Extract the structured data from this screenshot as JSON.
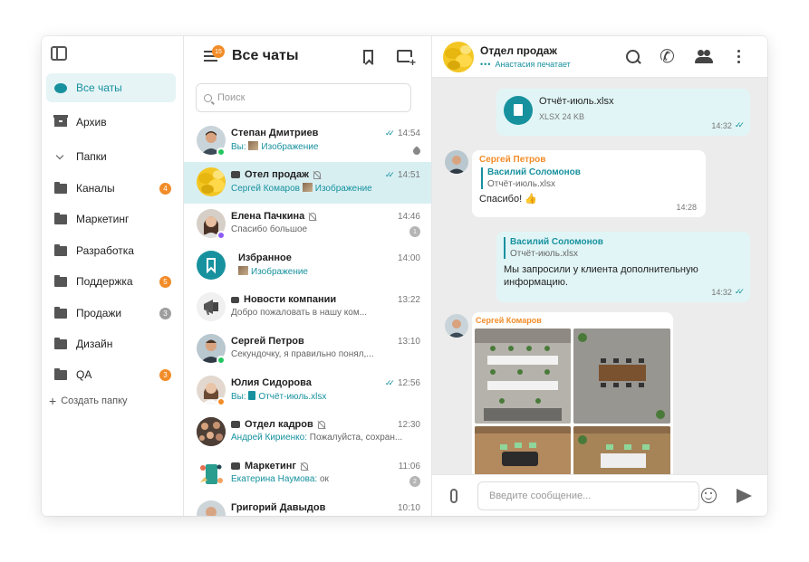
{
  "nav": {
    "items": [
      {
        "label": "Все чаты",
        "icon": "chat-icon",
        "active": true
      },
      {
        "label": "Архив",
        "icon": "archive-icon"
      },
      {
        "label": "Папки",
        "icon": "chevron-down-icon"
      },
      {
        "label": "Каналы",
        "icon": "folder-icon",
        "badge": "4",
        "badge_color": "orange"
      },
      {
        "label": "Маркетинг",
        "icon": "folder-icon"
      },
      {
        "label": "Разработка",
        "icon": "folder-icon"
      },
      {
        "label": "Поддержка",
        "icon": "folder-icon",
        "badge": "5",
        "badge_color": "orange"
      },
      {
        "label": "Продажи",
        "icon": "folder-icon",
        "badge": "3",
        "badge_color": "grey"
      },
      {
        "label": "Дизайн",
        "icon": "folder-icon"
      },
      {
        "label": "QA",
        "icon": "folder-icon",
        "badge": "3",
        "badge_color": "orange"
      }
    ],
    "create_folder": "Создать папку"
  },
  "list": {
    "title": "Все чаты",
    "menu_badge": "15",
    "search_placeholder": "Поиск",
    "chats": [
      {
        "name": "Степан Дмитриев",
        "prefix": "Вы: ",
        "preview": "Изображение",
        "time": "14:54",
        "read": true,
        "pinned": true,
        "status": "#22c55e",
        "avatar": "person1"
      },
      {
        "name": "Отел продаж",
        "group": true,
        "muted": true,
        "prefix": "Сергей Комаров ",
        "preview": "Изображение",
        "time": "14:51",
        "read": true,
        "active": true,
        "avatar": "lemons"
      },
      {
        "name": "Елена Пачкина",
        "muted": true,
        "prefix": "",
        "preview": "Спасибо большое",
        "time": "14:46",
        "unread": "1",
        "status": "#8b5cf6",
        "avatar": "person2"
      },
      {
        "name": "Избранное",
        "prefix": "",
        "preview": "Изображение",
        "time": "14:00",
        "avatar": "bookmark"
      },
      {
        "name": "Новости компании",
        "channel": true,
        "prefix": "",
        "preview": "Добро пожаловать в нашу ком...",
        "time": "13:22",
        "avatar": "megaphone"
      },
      {
        "name": "Сергей Петров",
        "prefix": "",
        "preview": "Секундочку, я правильно понял,...",
        "time": "13:10",
        "status": "#22c55e",
        "avatar": "person3"
      },
      {
        "name": "Юлия Сидорова",
        "prefix": "Вы: ",
        "preview": "Отчёт-июль.xlsx",
        "time": "12:56",
        "read": true,
        "status": "#f28c28",
        "avatar": "person4"
      },
      {
        "name": "Отдел кадров",
        "group": true,
        "muted": true,
        "prefix": "Андрей Кириенко: ",
        "preview": "Пожалуйста, сохран...",
        "time": "12:30",
        "avatar": "team"
      },
      {
        "name": "Маркетинг",
        "group": true,
        "muted": true,
        "prefix": "Екатерина Наумова: ",
        "preview": "ок",
        "time": "11:06",
        "unread": "2",
        "avatar": "marketing"
      },
      {
        "name": "Григорий Давыдов",
        "prefix": "",
        "preview": "",
        "time": "10:10",
        "avatar": "person5"
      }
    ]
  },
  "conversation": {
    "title": "Отдел продаж",
    "typing": "Анастасия печатает",
    "messages": {
      "file": {
        "name": "Отчёт-июль.xlsx",
        "meta": "XLSX 24 KB",
        "time": "14:32"
      },
      "reply_in": {
        "sender": "Сергей Петров",
        "quote_name": "Василий Соломонов",
        "quote_text": "Отчёт-июль.xlsx",
        "text": "Спасибо! 👍",
        "time": "14:28"
      },
      "reply_out": {
        "quote_name": "Василий Соломонов",
        "quote_text": "Отчёт-июль.xlsx",
        "text": "Мы запросили у клиента дополнительную информацию.",
        "time": "14:32"
      },
      "photos": {
        "sender": "Сергей Комаров"
      }
    },
    "input_placeholder": "Введите сообщение..."
  },
  "colors": {
    "accent": "#17919e",
    "badge_orange": "#f28c28",
    "active_row": "#d8eff2",
    "bubble_out": "#e1f5f6"
  }
}
